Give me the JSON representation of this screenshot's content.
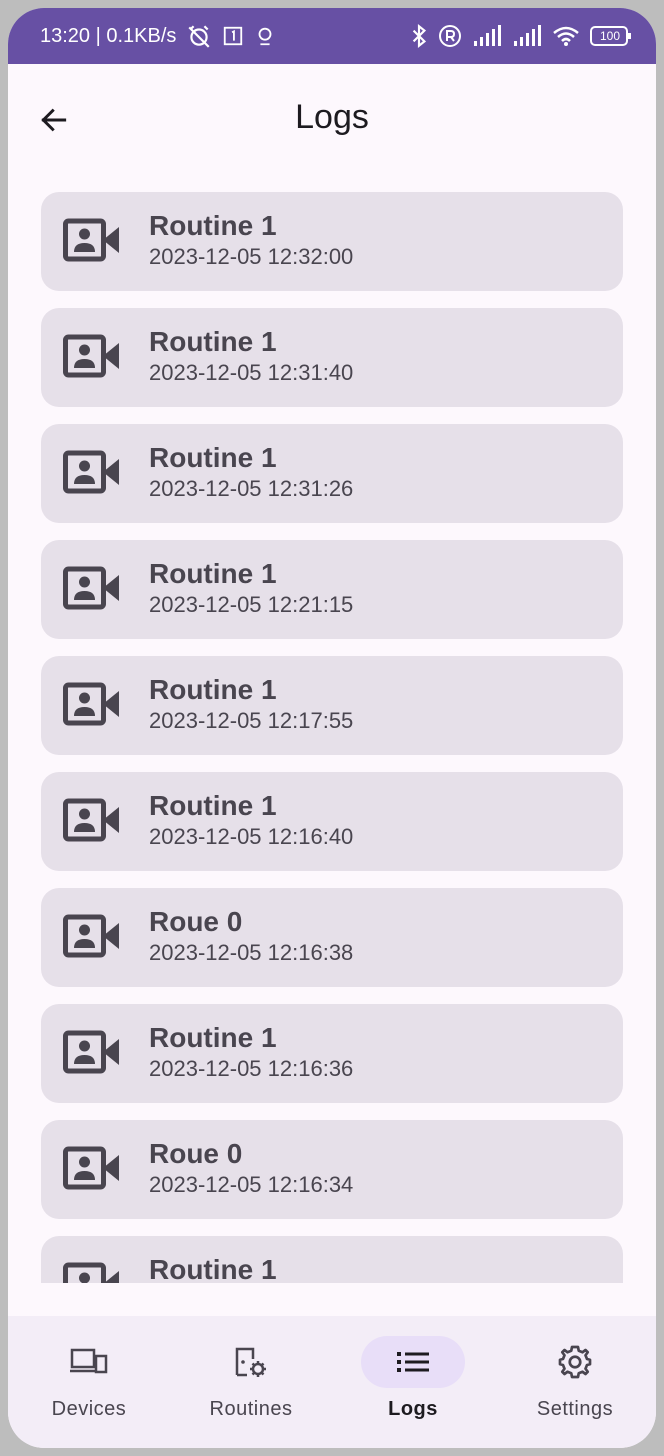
{
  "status_bar": {
    "time_speed": "13:20 | 0.1KB/s",
    "battery": "100"
  },
  "header": {
    "title": "Logs"
  },
  "logs": [
    {
      "title": "Routine 1",
      "time": "2023-12-05 12:32:00"
    },
    {
      "title": "Routine 1",
      "time": "2023-12-05 12:31:40"
    },
    {
      "title": "Routine 1",
      "time": "2023-12-05 12:31:26"
    },
    {
      "title": "Routine 1",
      "time": "2023-12-05 12:21:15"
    },
    {
      "title": "Routine 1",
      "time": "2023-12-05 12:17:55"
    },
    {
      "title": "Routine 1",
      "time": "2023-12-05 12:16:40"
    },
    {
      "title": "Roue 0",
      "time": "2023-12-05 12:16:38"
    },
    {
      "title": "Routine 1",
      "time": "2023-12-05 12:16:36"
    },
    {
      "title": "Roue 0",
      "time": "2023-12-05 12:16:34"
    },
    {
      "title": "Routine 1",
      "time": ""
    }
  ],
  "nav": {
    "items": [
      {
        "label": "Devices",
        "icon": "devices-icon"
      },
      {
        "label": "Routines",
        "icon": "routines-icon"
      },
      {
        "label": "Logs",
        "icon": "list-icon",
        "active": true
      },
      {
        "label": "Settings",
        "icon": "gear-icon"
      }
    ]
  },
  "colors": {
    "status_bar": "#6750a4",
    "card": "#e6e0e9",
    "nav_bg": "#f3edf7",
    "nav_active": "#e8def8"
  }
}
